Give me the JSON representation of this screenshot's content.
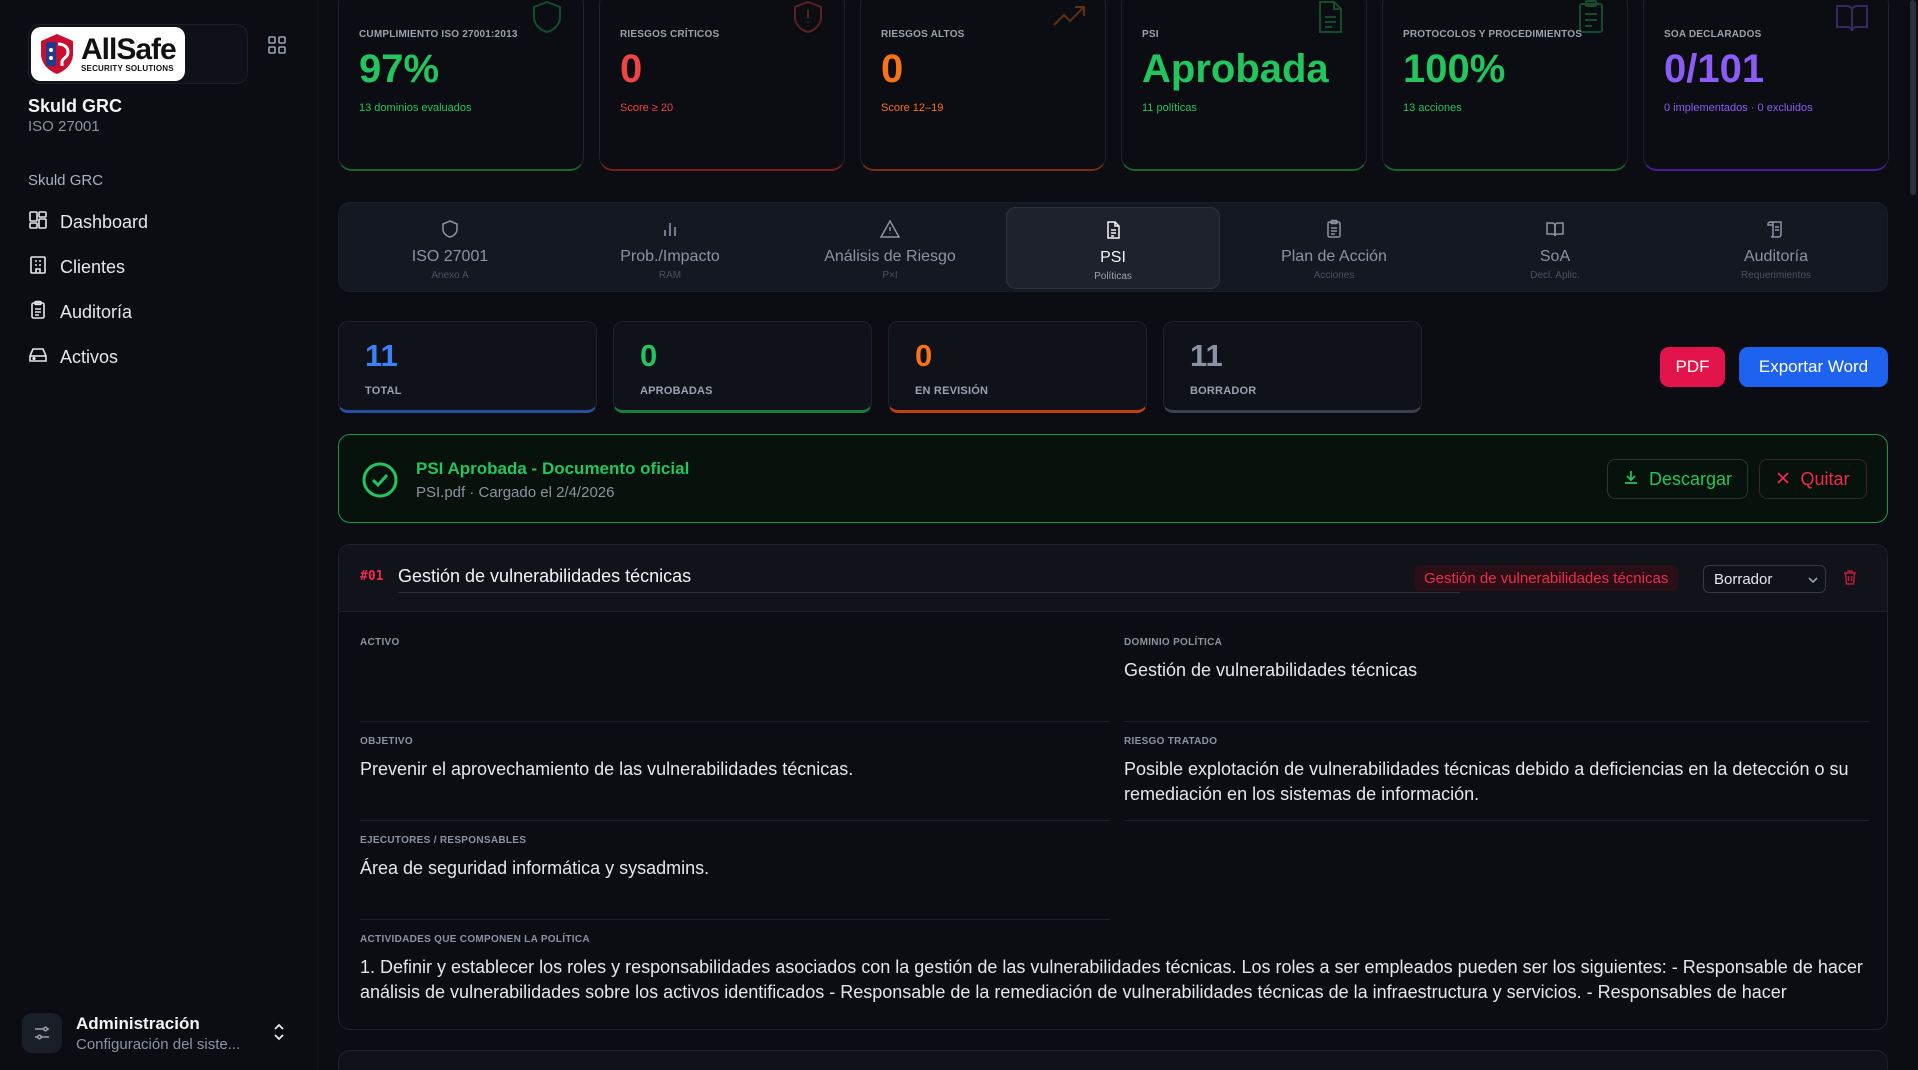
{
  "sidebar": {
    "logo_text": "AllSafe",
    "logo_sub": "SECURITY SOLUTIONS",
    "brand_name": "Skuld GRC",
    "brand_sub": "ISO 27001",
    "nav_heading": "Skuld GRC",
    "items": [
      {
        "label": "Dashboard",
        "icon": "dashboard-icon"
      },
      {
        "label": "Clientes",
        "icon": "building-icon"
      },
      {
        "label": "Auditoría",
        "icon": "clipboard-icon"
      },
      {
        "label": "Activos",
        "icon": "hard-drive-icon"
      }
    ],
    "admin_title": "Administración",
    "admin_sub": "Configuración del siste..."
  },
  "kpis": [
    {
      "label": "CUMPLIMIENTO ISO 27001:2013",
      "value": "97%",
      "note": "13 dominios evaluados",
      "color": "#22c55e",
      "icon": "shield-icon"
    },
    {
      "label": "RIESGOS CRÍTICOS",
      "value": "0",
      "note": "Score ≥ 20",
      "color": "#ef4444",
      "icon": "shield-alert-icon"
    },
    {
      "label": "RIESGOS ALTOS",
      "value": "0",
      "note": "Score 12–19",
      "color": "#f97316",
      "icon": "trending-up-icon"
    },
    {
      "label": "PSI",
      "value": "Aprobada",
      "note": "11 políticas",
      "color": "#22c55e",
      "icon": "file-text-icon"
    },
    {
      "label": "PROTOCOLOS Y PROCEDIMIENTOS",
      "value": "100%",
      "note": "13 acciones",
      "color": "#22c55e",
      "icon": "clipboard-list-icon"
    },
    {
      "label": "SOA DECLARADOS",
      "value": "0/101",
      "note": "0 implementados · 0 excluidos",
      "color": "#8b5cf6",
      "icon": "book-open-icon"
    }
  ],
  "tabs": [
    {
      "label": "ISO 27001",
      "sub": "Anexo A",
      "icon": "shield-icon"
    },
    {
      "label": "Prob./Impacto",
      "sub": "RAM",
      "icon": "bar-chart-icon"
    },
    {
      "label": "Análisis de Riesgo",
      "sub": "P×I",
      "icon": "warning-triangle-icon"
    },
    {
      "label": "PSI",
      "sub": "Políticas",
      "icon": "file-text-icon"
    },
    {
      "label": "Plan de Acción",
      "sub": "Acciones",
      "icon": "clipboard-list-icon"
    },
    {
      "label": "SoA",
      "sub": "Decl. Aplic.",
      "icon": "book-open-icon"
    },
    {
      "label": "Auditoría",
      "sub": "Requerimientos",
      "icon": "scroll-icon"
    }
  ],
  "stats": [
    {
      "value": "11",
      "label": "TOTAL",
      "color": "#3b82f6"
    },
    {
      "value": "0",
      "label": "APROBADAS",
      "color": "#22c55e"
    },
    {
      "value": "0",
      "label": "EN REVISIÓN",
      "color": "#f97316"
    },
    {
      "value": "11",
      "label": "BORRADOR",
      "color": "#8b93a3"
    }
  ],
  "actions": {
    "pdf": "PDF",
    "word": "Exportar Word"
  },
  "banner": {
    "title": "PSI Aprobada - Documento oficial",
    "sub": "PSI.pdf · Cargado el 2/4/2026",
    "download": "Descargar",
    "remove": "Quitar"
  },
  "policy": {
    "number": "#01",
    "title": "Gestión de vulnerabilidades técnicas",
    "badge": "Gestión de vulnerabilidades técnicas",
    "status": "Borrador",
    "fields": {
      "activo_label": "ACTIVO",
      "activo_value": "",
      "dominio_label": "DOMINIO POLÍTICA",
      "dominio_value": "Gestión de vulnerabilidades técnicas",
      "objetivo_label": "OBJETIVO",
      "objetivo_value": "Prevenir el aprovechamiento de las vulnerabilidades técnicas.",
      "riesgo_label": "RIESGO TRATADO",
      "riesgo_value": "Posible explotación de vulnerabilidades técnicas debido a deficiencias en la detección o su remediación en los sistemas de información.",
      "ejecutores_label": "EJECUTORES / RESPONSABLES",
      "ejecutores_value": "Área de seguridad informática y sysadmins.",
      "actividades_label": "ACTIVIDADES QUE COMPONEN LA POLÍTICA",
      "actividades_value": "1. Definir y establecer los roles y responsabilidades asociados con la gestión de las vulnerabilidades técnicas. Los roles a ser empleados pueden ser los siguientes: - Responsable de hacer análisis de vulnerabilidades sobre los activos identificados - Responsable de la remediación de vulnerabilidades técnicas de la infraestructura y servicios. - Responsables de hacer"
    }
  }
}
